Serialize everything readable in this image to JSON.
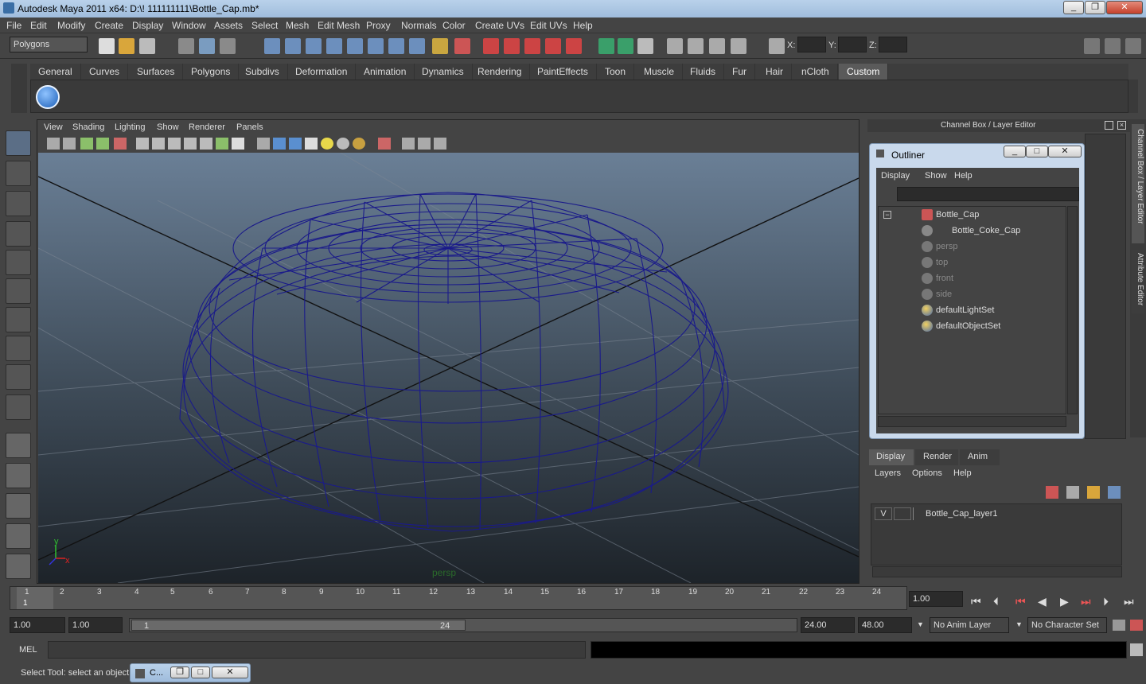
{
  "window": {
    "title": "Autodesk Maya 2011 x64: D:\\! 111111111\\Bottle_Cap.mb*",
    "minimize": "_",
    "maximize": "❐",
    "close": "✕"
  },
  "menu": [
    "File",
    "Edit",
    "Modify",
    "Create",
    "Display",
    "Window",
    "Assets",
    "Select",
    "Mesh",
    "Edit Mesh",
    "Proxy",
    "Normals",
    "Color",
    "Create UVs",
    "Edit UVs",
    "Help"
  ],
  "status": {
    "mode": "Polygons",
    "x_label": "X:",
    "y_label": "Y:",
    "z_label": "Z:"
  },
  "shelf_tabs": [
    "General",
    "Curves",
    "Surfaces",
    "Polygons",
    "Subdivs",
    "Deformation",
    "Animation",
    "Dynamics",
    "Rendering",
    "PaintEffects",
    "Toon",
    "Muscle",
    "Fluids",
    "Fur",
    "Hair",
    "nCloth",
    "Custom"
  ],
  "shelf_active": "Custom",
  "viewport": {
    "menu": [
      "View",
      "Shading",
      "Lighting",
      "Show",
      "Renderer",
      "Panels"
    ],
    "camera_label": "persp",
    "axis_y": "y",
    "axis_x": "x"
  },
  "channel_box": {
    "title": "Channel Box / Layer Editor",
    "side_tab1": "Channel Box / Layer Editor",
    "side_tab2": "Attribute Editor"
  },
  "outliner": {
    "title": "Outliner",
    "menu": [
      "Display",
      "Show",
      "Help"
    ],
    "items": [
      {
        "label": "Bottle_Cap",
        "dim": false
      },
      {
        "label": "Bottle_Coke_Cap",
        "dim": false
      },
      {
        "label": "persp",
        "dim": true
      },
      {
        "label": "top",
        "dim": true
      },
      {
        "label": "front",
        "dim": true
      },
      {
        "label": "side",
        "dim": true
      },
      {
        "label": "defaultLightSet",
        "dim": false
      },
      {
        "label": "defaultObjectSet",
        "dim": false
      }
    ]
  },
  "layer_editor": {
    "tabs": [
      "Display",
      "Render",
      "Anim"
    ],
    "menu": [
      "Layers",
      "Options",
      "Help"
    ],
    "layer_visible": "V",
    "layer_name": "Bottle_Cap_layer1"
  },
  "timeline": {
    "ticks": [
      "1",
      "2",
      "3",
      "4",
      "5",
      "6",
      "7",
      "8",
      "9",
      "10",
      "11",
      "12",
      "13",
      "14",
      "15",
      "16",
      "17",
      "18",
      "19",
      "20",
      "21",
      "22",
      "23",
      "24"
    ],
    "current": "1",
    "current_time": "1.00"
  },
  "range": {
    "start": "1.00",
    "start2": "1.00",
    "slider_start": "1",
    "slider_end": "24",
    "end": "24.00",
    "end2": "48.00",
    "anim_layer": "No Anim Layer",
    "character_set": "No Character Set"
  },
  "command": {
    "label": "MEL"
  },
  "help": {
    "text": "Select Tool: select an object",
    "mini_window": "C..."
  }
}
